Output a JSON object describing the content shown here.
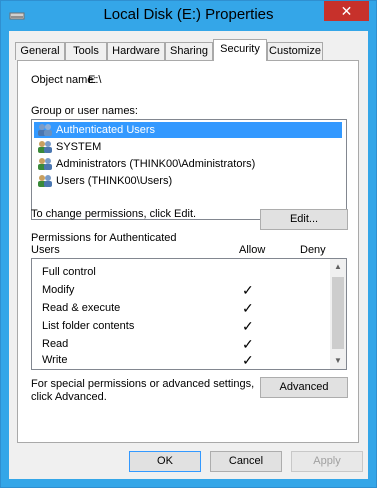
{
  "window": {
    "title": "Local Disk (E:) Properties",
    "close_glyph": "✕",
    "close_color": "#c7312b",
    "accent_color": "#34a6e8"
  },
  "tabs": [
    {
      "label": "General"
    },
    {
      "label": "Tools"
    },
    {
      "label": "Hardware"
    },
    {
      "label": "Sharing"
    },
    {
      "label": "Security",
      "active": true
    },
    {
      "label": "Customize"
    }
  ],
  "security": {
    "object_name_label": "Object name:",
    "object_name_value": "E:\\",
    "group_label": "Group or user names:",
    "users": [
      {
        "name": "Authenticated Users",
        "selected": true
      },
      {
        "name": "SYSTEM"
      },
      {
        "name": "Administrators (THINK00\\Administrators)"
      },
      {
        "name": "Users (THINK00\\Users)"
      }
    ],
    "change_text": "To change permissions, click Edit.",
    "edit_button": "Edit...",
    "perms_label_line1": "Permissions for Authenticated",
    "perms_label_line2": "Users",
    "allow_header": "Allow",
    "deny_header": "Deny",
    "permissions": [
      {
        "name": "Full control",
        "allow": ""
      },
      {
        "name": "Modify",
        "allow": "✓"
      },
      {
        "name": "Read & execute",
        "allow": "✓"
      },
      {
        "name": "List folder contents",
        "allow": "✓"
      },
      {
        "name": "Read",
        "allow": "✓"
      },
      {
        "name": "Write",
        "allow": "✓"
      }
    ],
    "special_text_line1": "For special permissions or advanced settings,",
    "special_text_line2": "click Advanced.",
    "advanced_button": "Advanced"
  },
  "footer": {
    "ok_button": "OK",
    "cancel_button": "Cancel",
    "apply_button": "Apply"
  },
  "icons": {
    "title": "drive-icon",
    "user": "user-group-icon",
    "check": "checkmark-icon",
    "scroll_up": "chevron-up-icon",
    "scroll_down": "chevron-down-icon"
  }
}
